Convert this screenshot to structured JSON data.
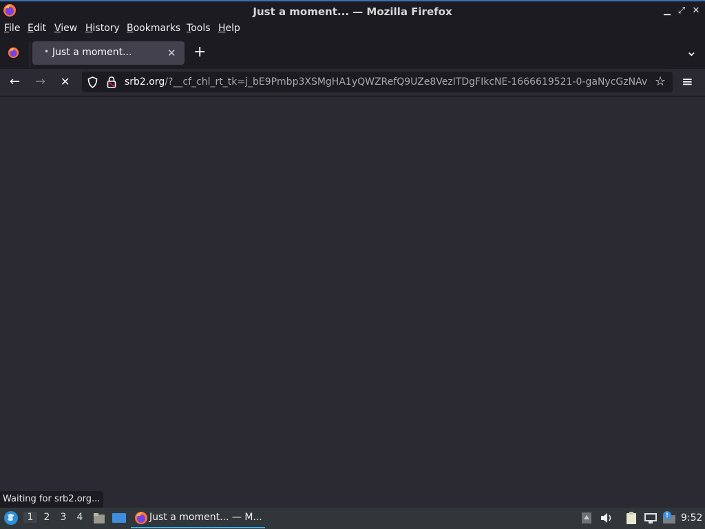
{
  "window": {
    "title": "Just a moment... — Mozilla Firefox"
  },
  "menubar": {
    "items": [
      {
        "label": "File",
        "mnemonic": "F",
        "rest": "ile"
      },
      {
        "label": "Edit",
        "mnemonic": "E",
        "rest": "dit"
      },
      {
        "label": "View",
        "mnemonic": "V",
        "rest": "iew"
      },
      {
        "label": "History",
        "mnemonic": "H",
        "rest": "istory"
      },
      {
        "label": "Bookmarks",
        "mnemonic": "B",
        "rest": "ookmarks"
      },
      {
        "label": "Tools",
        "mnemonic": "T",
        "rest": "ools"
      },
      {
        "label": "Help",
        "mnemonic": "H",
        "rest": "elp"
      }
    ]
  },
  "tabs": [
    {
      "title": "Just a moment...",
      "loading_dot": "•",
      "close": "✕",
      "active": true
    }
  ],
  "tabbar": {
    "new_tab": "+",
    "list_all_tabs": "⌄"
  },
  "navbar": {
    "url_domain": "srb2.org",
    "url_rest": "/?__cf_chl_rt_tk=j_bE9Pmbp3XSMgHA1yQWZRefQ9UZe8VezITDgFIkcNE-1666619521-0-gaNycGzNAv",
    "back_icon": "←",
    "forward_icon": "→",
    "stop_icon": "✕",
    "bookmark_icon": "☆",
    "menu_icon": "≡"
  },
  "status": {
    "text": "Waiting for srb2.org..."
  },
  "taskbar": {
    "workspaces": [
      "1",
      "2",
      "3",
      "4"
    ],
    "active_workspace": "1",
    "task_label": "Just a moment... — M...",
    "clock": "9:52"
  },
  "colors": {
    "accent": "#3daee9",
    "titlebar_border": "#3b6fb6"
  }
}
